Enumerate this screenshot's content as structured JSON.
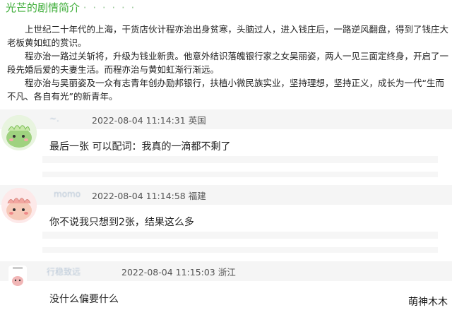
{
  "section": {
    "title": "光芒的剧情简介",
    "dots": "· · · · · ·"
  },
  "synopsis": {
    "paragraphs": [
      "上世纪二十年代的上海，干货店伙计程亦治出身贫寒，头脑过人，进入钱庄后，一路逆风翻盘，得到了钱庄大老板黄如虹的赏识。",
      "程亦治一路过关斩将，升级为钱业新贵。他意外结识落魄银行家之女吴丽姿，两人一见三面定终身，开启了一段先婚后爱的夫妻生活。而程亦治与黄如虹渐行渐远。",
      "程亦治与吴丽姿及一众有志青年创办励邦银行，扶植小微民族实业，坚持理想，坚持正义，成长为一代“生而不凡、各自有光”的新青年。"
    ]
  },
  "comments": [
    {
      "username": "~.",
      "time": "2022-08-04 11:14:31",
      "location": "英国",
      "text": "最后一张 可以配词：我真的一滴都不剩了",
      "avatar": "green-dino-avatar"
    },
    {
      "username": "momo",
      "time": "2022-08-04 11:14:58",
      "location": "福建",
      "text": "你不说我只想到2张，结果这么多",
      "avatar": "pink-dino-avatar"
    },
    {
      "username": "行稳致远",
      "time": "2022-08-04 11:15:03",
      "location": "浙江",
      "text": "没什么偏要什么",
      "avatar": "small-pink-avatar"
    }
  ],
  "watermark": "萌神木木",
  "colors": {
    "title_green": "#3fae3a",
    "comment_header_bg": "#f5f5f5",
    "username_blue": "#b7c6d6"
  }
}
